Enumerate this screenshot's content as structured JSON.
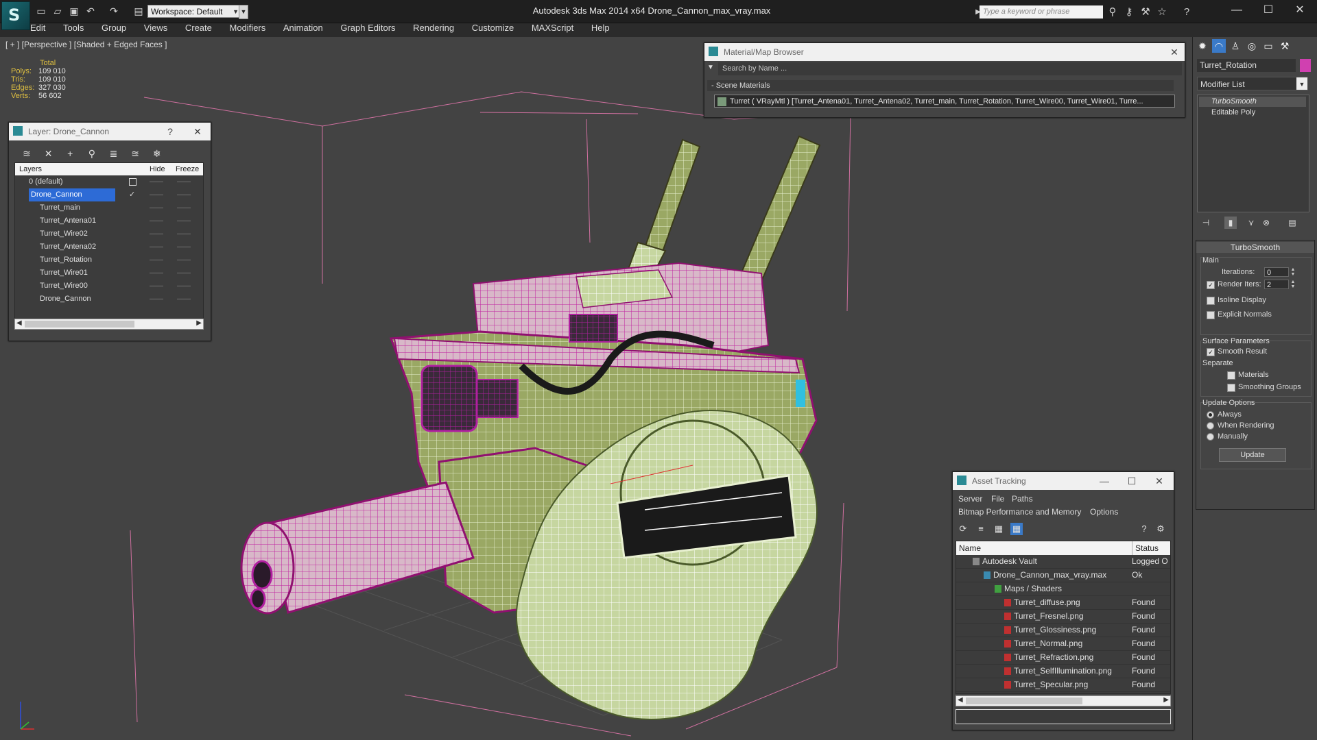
{
  "app": {
    "title": "Autodesk 3ds Max  2014 x64     Drone_Cannon_max_vray.max",
    "workspace_label": "Workspace: Default",
    "search_placeholder": "Type a keyword or phrase"
  },
  "menu": [
    "Edit",
    "Tools",
    "Group",
    "Views",
    "Create",
    "Modifiers",
    "Animation",
    "Graph Editors",
    "Rendering",
    "Customize",
    "MAXScript",
    "Help"
  ],
  "viewport": {
    "label": "[ + ] [Perspective ] [Shaded + Edged Faces ]",
    "stats_header": "Total",
    "stats": [
      {
        "label": "Polys:",
        "value": "109 010"
      },
      {
        "label": "Tris:",
        "value": "109 010"
      },
      {
        "label": "Edges:",
        "value": "327 030"
      },
      {
        "label": "Verts:",
        "value": "56 602"
      }
    ]
  },
  "layer_window": {
    "title": "Layer: Drone_Cannon",
    "help": "?",
    "col_layers": "Layers",
    "col_hide": "Hide",
    "col_freeze": "Freeze",
    "rows": [
      {
        "name": "0 (default)",
        "hide": "——",
        "freeze": "——"
      },
      {
        "name": "Drone_Cannon",
        "hide": "——",
        "freeze": "——"
      },
      {
        "name": "Turret_main",
        "hide": "——",
        "freeze": "——"
      },
      {
        "name": "Turret_Antena01",
        "hide": "——",
        "freeze": "——"
      },
      {
        "name": "Turret_Wire02",
        "hide": "——",
        "freeze": "——"
      },
      {
        "name": "Turret_Antena02",
        "hide": "——",
        "freeze": "——"
      },
      {
        "name": "Turret_Rotation",
        "hide": "——",
        "freeze": "——"
      },
      {
        "name": "Turret_Wire01",
        "hide": "——",
        "freeze": "——"
      },
      {
        "name": "Turret_Wire00",
        "hide": "——",
        "freeze": "——"
      },
      {
        "name": "Drone_Cannon",
        "hide": "——",
        "freeze": "——"
      }
    ]
  },
  "material_browser": {
    "title": "Material/Map Browser",
    "search_placeholder": "Search by Name ...",
    "section": "- Scene Materials",
    "material_row": "Turret  ( VRayMtl )  [Turret_Antena01, Turret_Antena02, Turret_main, Turret_Rotation, Turret_Wire00, Turret_Wire01, Turre..."
  },
  "asset_tracking": {
    "title": "Asset Tracking",
    "menu1": [
      "Server",
      "File",
      "Paths"
    ],
    "menu2": [
      "Bitmap Performance and Memory",
      "Options"
    ],
    "col_name": "Name",
    "col_status": "Status",
    "rows": [
      {
        "name": "Autodesk Vault",
        "status": "Logged O"
      },
      {
        "name": "Drone_Cannon_max_vray.max",
        "status": "Ok"
      },
      {
        "name": "Maps / Shaders",
        "status": ""
      },
      {
        "name": "Turret_diffuse.png",
        "status": "Found"
      },
      {
        "name": "Turret_Fresnel.png",
        "status": "Found"
      },
      {
        "name": "Turret_Glossiness.png",
        "status": "Found"
      },
      {
        "name": "Turret_Normal.png",
        "status": "Found"
      },
      {
        "name": "Turret_Refraction.png",
        "status": "Found"
      },
      {
        "name": "Turret_SelfIllumination.png",
        "status": "Found"
      },
      {
        "name": "Turret_Specular.png",
        "status": "Found"
      }
    ]
  },
  "command_panel": {
    "object_name": "Turret_Rotation",
    "object_color": "#d040b0",
    "modifier_list": "Modifier List",
    "stack": [
      "TurboSmooth",
      "Editable Poly"
    ],
    "rollout_title": "TurboSmooth",
    "main_label": "Main",
    "iterations_label": "Iterations:",
    "iterations_value": "0",
    "render_iters_label": "Render Iters:",
    "render_iters_value": "2",
    "isoline": "Isoline Display",
    "explicit_normals": "Explicit Normals",
    "surface_params": "Surface Parameters",
    "smooth_result": "Smooth Result",
    "separate": "Separate",
    "materials": "Materials",
    "smoothing_groups": "Smoothing Groups",
    "update_options": "Update Options",
    "always": "Always",
    "when_rendering": "When Rendering",
    "manually": "Manually",
    "update_button": "Update"
  }
}
